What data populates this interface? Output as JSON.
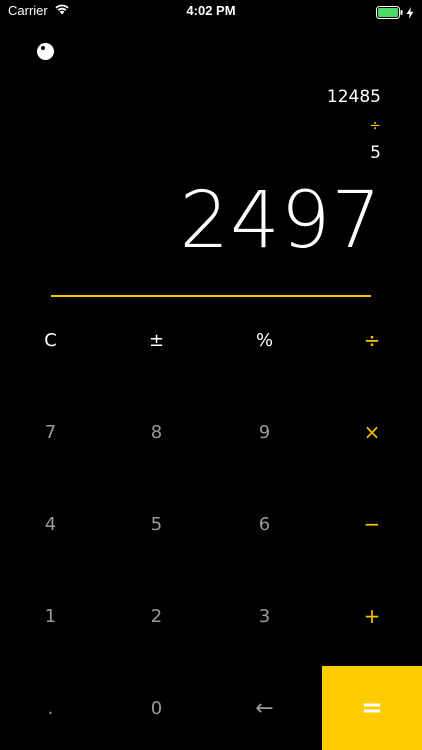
{
  "status_bar": {
    "carrier": "Carrier",
    "time": "4:02 PM",
    "icons": [
      "wifi-icon",
      "battery-icon",
      "charging-bolt-icon"
    ]
  },
  "display": {
    "history": {
      "operand1": "12485",
      "operator": "÷",
      "operand2": "5"
    },
    "result": "2497"
  },
  "keypad": {
    "row1": [
      "C",
      "±",
      "%",
      "÷"
    ],
    "row2": [
      "7",
      "8",
      "9",
      "×"
    ],
    "row3": [
      "4",
      "5",
      "6",
      "−"
    ],
    "row4": [
      "1",
      "2",
      "3",
      "+"
    ],
    "row5": [
      ".",
      "0",
      "←",
      "="
    ]
  },
  "colors": {
    "background": "#000000",
    "accent": "#f7c100",
    "equals_background": "#ffcc00",
    "digit_text": "#9a9a9a",
    "function_text": "#ffffff",
    "battery": "#4cd964"
  }
}
